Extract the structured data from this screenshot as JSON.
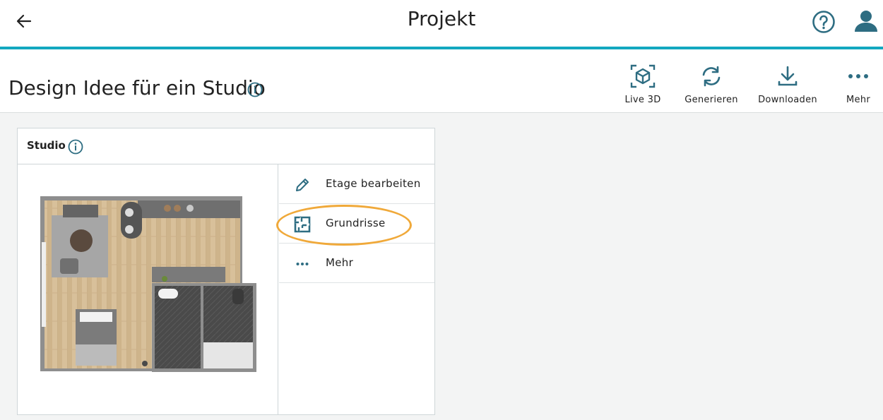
{
  "app": {
    "title": "Projekt"
  },
  "project": {
    "title": "Design Idee für ein Studio"
  },
  "toolbar": [
    {
      "label": "Live 3D",
      "icon": "cube-3d-icon"
    },
    {
      "label": "Generieren",
      "icon": "refresh-icon"
    },
    {
      "label": "Downloaden",
      "icon": "download-icon"
    },
    {
      "label": "Mehr",
      "icon": "more-icon"
    }
  ],
  "floor": {
    "name": "Studio",
    "menu": [
      {
        "label": "Etage bearbeiten",
        "icon": "pencil-icon"
      },
      {
        "label": "Grundrisse",
        "icon": "floorplan-icon"
      },
      {
        "label": "Mehr",
        "icon": "more-icon"
      }
    ]
  },
  "colors": {
    "accent": "#12a7bf",
    "icon": "#2e6d82",
    "highlight": "#f0a93a"
  }
}
